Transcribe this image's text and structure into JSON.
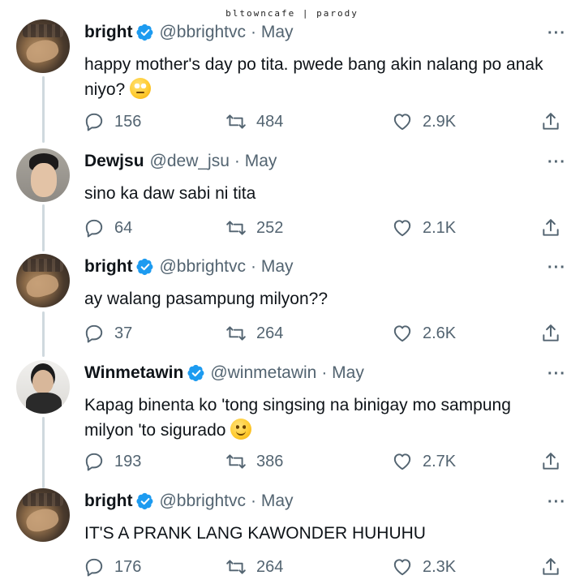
{
  "watermark": "bltowncafe | parody",
  "tweets": [
    {
      "name": "bright",
      "verified": true,
      "handle": "@bbrightvc",
      "date": "· May",
      "text": "happy mother's day po tita. pwede bang akin nalang po anak niyo?",
      "emoji": "face-with-rolling-eyes",
      "replies": "156",
      "retweets": "484",
      "likes": "2.9K"
    },
    {
      "name": "Dewjsu",
      "verified": false,
      "handle": "@dew_jsu",
      "date": "· May",
      "text": "sino ka daw sabi ni tita",
      "replies": "64",
      "retweets": "252",
      "likes": "2.1K"
    },
    {
      "name": "bright",
      "verified": true,
      "handle": "@bbrightvc",
      "date": "· May",
      "text": "ay walang pasampung milyon??",
      "replies": "37",
      "retweets": "264",
      "likes": "2.6K"
    },
    {
      "name": "Winmetawin",
      "verified": true,
      "handle": "@winmetawin",
      "date": "· May",
      "text": "Kapag binenta ko 'tong singsing na binigay mo sampung milyon 'to sigurado",
      "emoji": "slightly-smiling-face",
      "replies": "193",
      "retweets": "386",
      "likes": "2.7K"
    },
    {
      "name": "bright",
      "verified": true,
      "handle": "@bbrightvc",
      "date": "· May",
      "text": "IT'S A PRANK LANG KAWONDER HUHUHU",
      "replies": "176",
      "retweets": "264",
      "likes": "2.3K"
    }
  ],
  "more_label": "···",
  "colors": {
    "verified": "#1d9bf0",
    "secondary_text": "#536471",
    "thread_line": "#cfd9de"
  }
}
